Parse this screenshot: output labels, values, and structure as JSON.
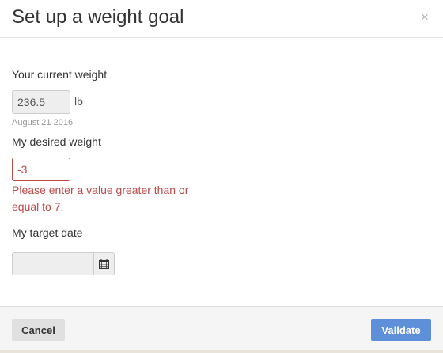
{
  "dialog": {
    "title": "Set up a weight goal",
    "close_glyph": "×"
  },
  "current_weight": {
    "label": "Your current weight",
    "value": "236.5",
    "unit": "lb",
    "date": "August 21 2016"
  },
  "desired_weight": {
    "label": "My desired weight",
    "value": "-3",
    "error": "Please enter a value greater than or equal to 7."
  },
  "target_date": {
    "label": "My target date",
    "value": "",
    "icon": "calendar-icon"
  },
  "footer": {
    "cancel_label": "Cancel",
    "validate_label": "Validate"
  },
  "colors": {
    "error": "#b94a48",
    "primary_button": "#5e8fd9",
    "secondary_button": "#e0e0e0",
    "footer_bg": "#f5f5f5"
  }
}
